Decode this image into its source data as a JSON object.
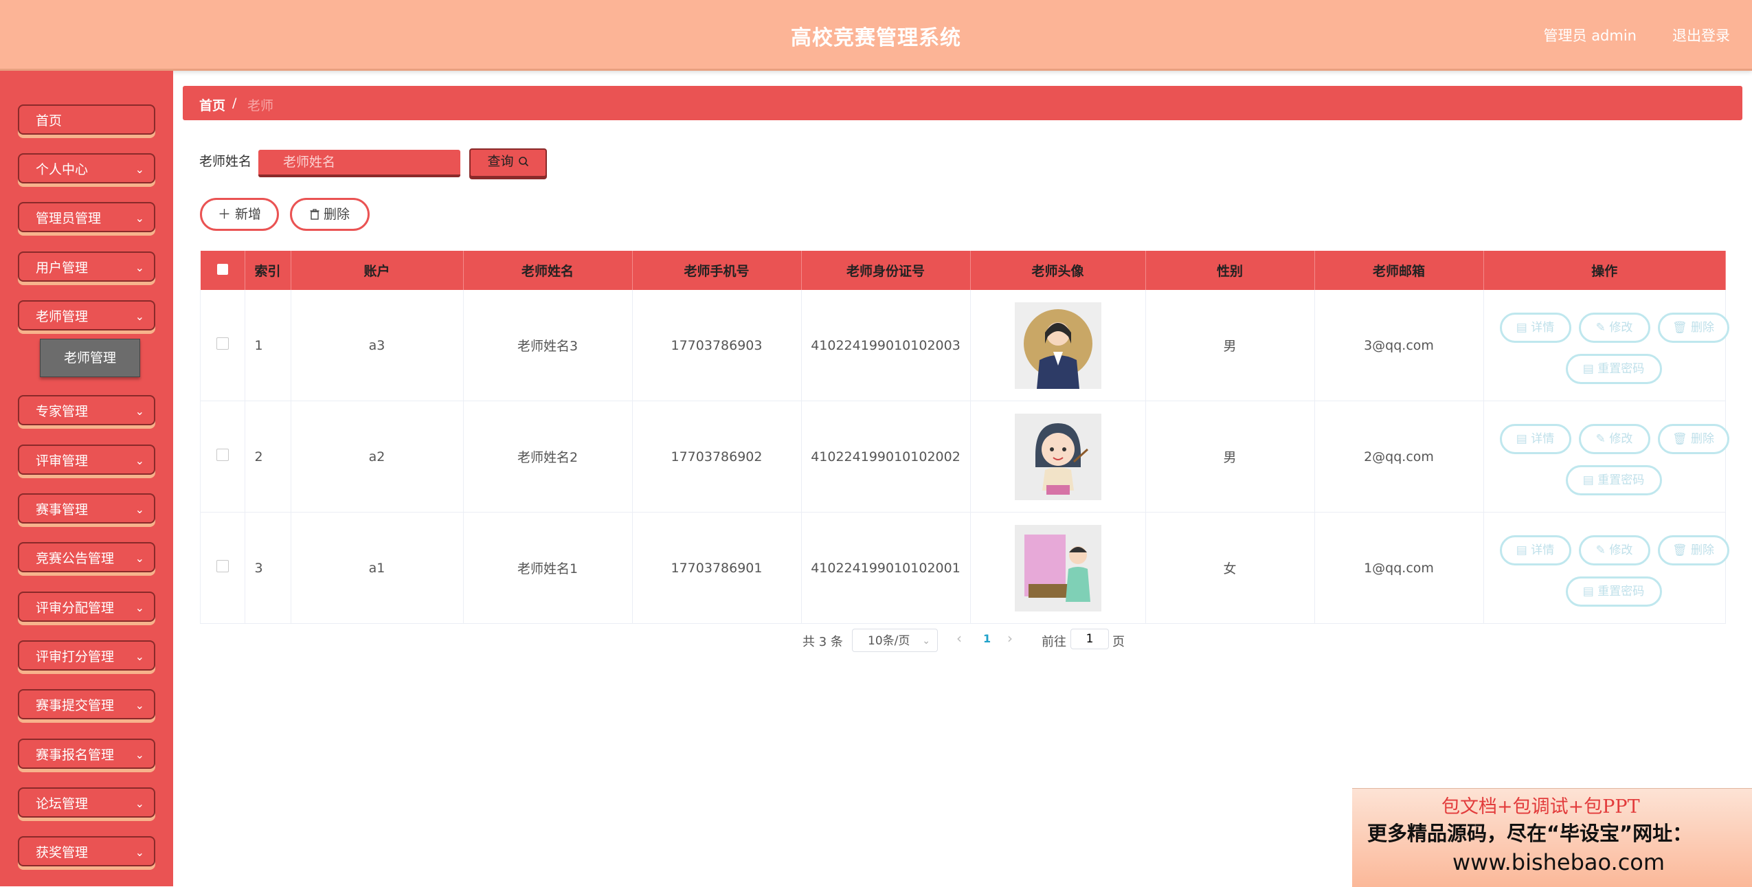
{
  "header": {
    "title": "高校竞赛管理系统",
    "admin": "管理员 admin",
    "logout": "退出登录"
  },
  "sidebar": {
    "items": [
      {
        "label": "首页"
      },
      {
        "label": "个人中心"
      },
      {
        "label": "管理员管理"
      },
      {
        "label": "用户管理"
      },
      {
        "label": "老师管理"
      },
      {
        "label": "专家管理"
      },
      {
        "label": "评审管理"
      },
      {
        "label": "赛事管理"
      },
      {
        "label": "竞赛公告管理"
      },
      {
        "label": "评审分配管理"
      },
      {
        "label": "评审打分管理"
      },
      {
        "label": "赛事提交管理"
      },
      {
        "label": "赛事报名管理"
      },
      {
        "label": "论坛管理"
      },
      {
        "label": "获奖管理"
      }
    ],
    "submenu": {
      "label": "老师管理"
    }
  },
  "breadcrumb": {
    "home": "首页",
    "separator": "/",
    "current": "老师"
  },
  "search": {
    "label": "老师姓名",
    "placeholder": "老师姓名",
    "button": "查询"
  },
  "actions": {
    "add": "新增",
    "delete": "删除"
  },
  "table": {
    "headers": [
      "索引",
      "账户",
      "老师姓名",
      "老师手机号",
      "老师身份证号",
      "老师头像",
      "性别",
      "老师邮箱",
      "操作"
    ],
    "rows": [
      {
        "index": "1",
        "account": "a3",
        "name": "老师姓名3",
        "phone": "17703786903",
        "id_card": "410224199010102003",
        "gender": "男",
        "email": "3@qq.com"
      },
      {
        "index": "2",
        "account": "a2",
        "name": "老师姓名2",
        "phone": "17703786902",
        "id_card": "410224199010102002",
        "gender": "男",
        "email": "2@qq.com"
      },
      {
        "index": "3",
        "account": "a1",
        "name": "老师姓名1",
        "phone": "17703786901",
        "id_card": "410224199010102001",
        "gender": "女",
        "email": "1@qq.com"
      }
    ],
    "row_actions": {
      "detail": "详情",
      "edit": "修改",
      "delete": "删除",
      "reset": "重置密码"
    }
  },
  "pagination": {
    "total": "共 3 条",
    "page_size": "10条/页",
    "current_page": "1",
    "goto_label": "前往",
    "goto_value": "1",
    "page_unit": "页"
  },
  "watermark": {
    "line1": "包文档+包调试+包PPT",
    "line2": "更多精品源码，尽在“毕设宝”网址：",
    "line3": "www.bishebao.com"
  }
}
